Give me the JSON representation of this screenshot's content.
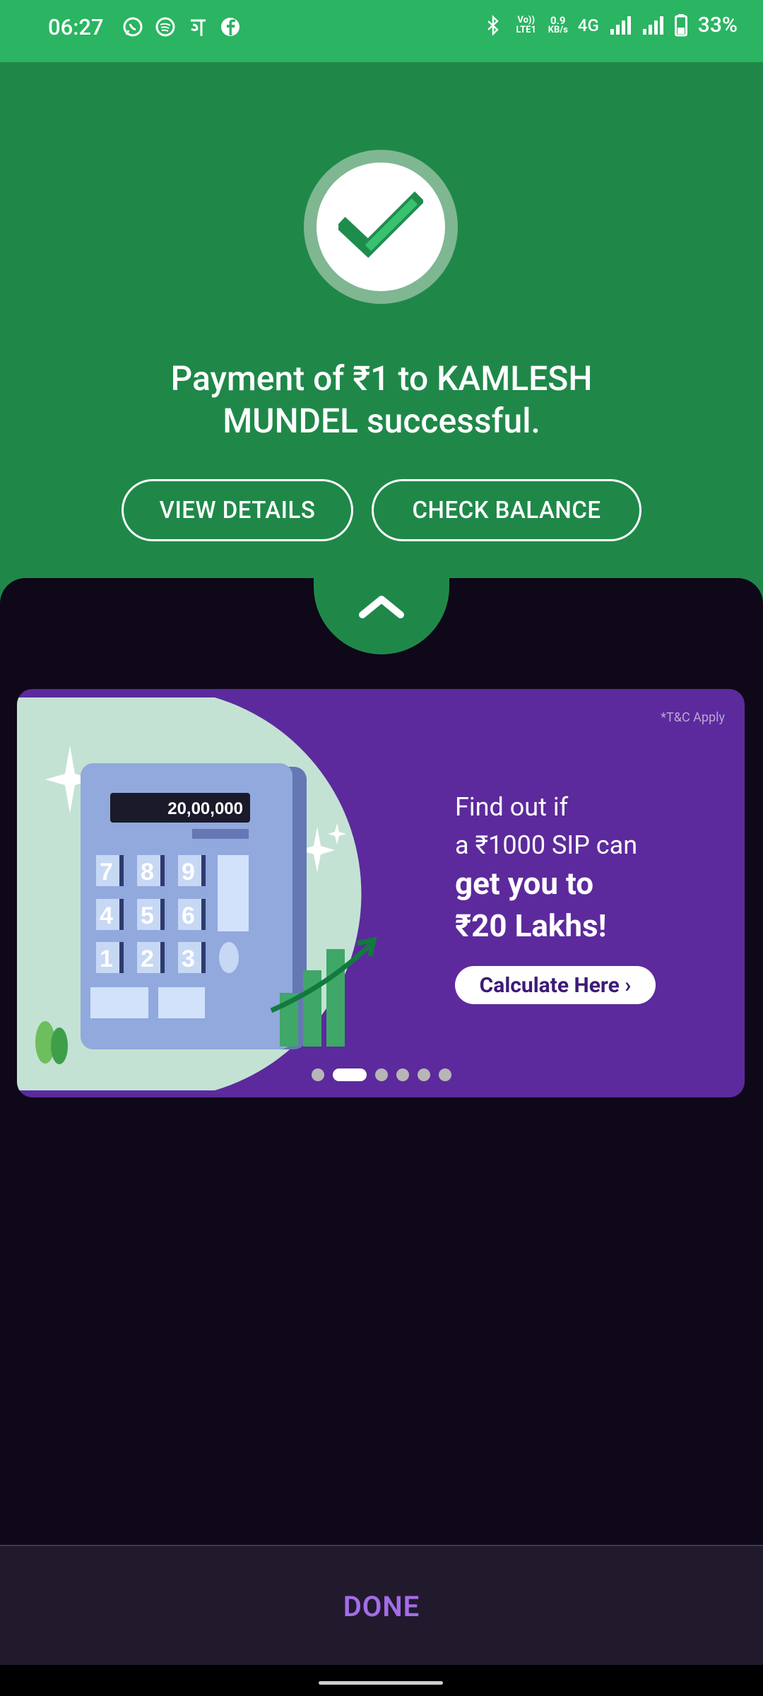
{
  "status_bar": {
    "time": "06:27",
    "left_icons": [
      "whatsapp-icon",
      "spotify-icon",
      "phonepe-icon",
      "facebook-icon"
    ],
    "network_speed_value": "0.9",
    "network_speed_unit": "KB/s",
    "volte_label": "Vo)) LTE1",
    "network_type": "4G",
    "battery": "33%"
  },
  "payment": {
    "message": "Payment of ₹1 to KAMLESH MUNDEL successful.",
    "view_details_label": "VIEW DETAILS",
    "check_balance_label": "CHECK BALANCE"
  },
  "banner": {
    "tc_text": "*T&C Apply",
    "calc_display": "20,00,000",
    "calc_keys": [
      "7",
      "8",
      "9",
      "4",
      "5",
      "6",
      "1",
      "2",
      "3"
    ],
    "line1": "Find out if",
    "line2": "a ₹1000 SIP can",
    "line3": "get you to",
    "line4": "₹20 Lakhs!",
    "cta_label": "Calculate Here ›",
    "carousel_count": 6,
    "carousel_active_index": 1
  },
  "footer": {
    "done_label": "DONE"
  },
  "colors": {
    "status_green": "#2bb462",
    "hero_green": "#1f8849",
    "background": "#0e0819",
    "banner_purple": "#5c2a9c",
    "done_purple": "#a46de7"
  }
}
